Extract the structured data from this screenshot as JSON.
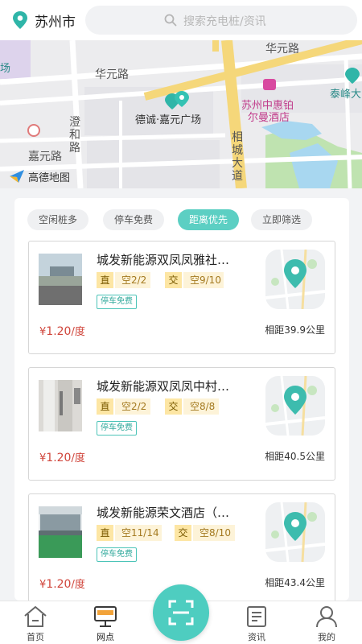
{
  "header": {
    "city": "苏州市",
    "search_placeholder": "搜索充电桩/资讯"
  },
  "map": {
    "labels": {
      "huayuan_road_top": "华元路",
      "huayuan_road_mid": "华元路",
      "huayuan_road_left": "嘉元路",
      "chenghe_road": "澄和路",
      "xiangcheng_ave": "相城大道",
      "poi_center": "德诚·嘉元广场",
      "hotel": "苏州中惠铂尔曼酒店",
      "hotel_line1": "苏州中惠铂",
      "hotel_line2": "尔曼酒店",
      "taifeng": "泰峰大",
      "left_edge": "场"
    },
    "logo_text": "高德地图"
  },
  "filters": [
    {
      "label": "空闲桩多",
      "active": false
    },
    {
      "label": "停车免费",
      "active": false
    },
    {
      "label": "距离优先",
      "active": true
    },
    {
      "label": "立即筛选",
      "active": false
    }
  ],
  "stations": [
    {
      "name": "城发新能源双凤凤雅社…",
      "dc_tag": "直",
      "dc_avail": "空2/2",
      "ac_tag": "交",
      "ac_avail": "空9/10",
      "badge": "停车免费",
      "price_symbol": "¥",
      "price_value": "1.20",
      "price_unit": "/度",
      "distance": "相距39.9公里"
    },
    {
      "name": "城发新能源双凤凤中村…",
      "dc_tag": "直",
      "dc_avail": "空2/2",
      "ac_tag": "交",
      "ac_avail": "空8/8",
      "badge": "停车免费",
      "price_symbol": "¥",
      "price_value": "1.20",
      "price_unit": "/度",
      "distance": "相距40.5公里"
    },
    {
      "name": "城发新能源荣文酒店（…",
      "dc_tag": "直",
      "dc_avail": "空11/14",
      "ac_tag": "交",
      "ac_avail": "空8/10",
      "badge": "停车免费",
      "price_symbol": "¥",
      "price_value": "1.20",
      "price_unit": "/度",
      "distance": "相距43.4公里"
    }
  ],
  "nav": [
    {
      "label": "首页",
      "icon": "home-icon",
      "active": false
    },
    {
      "label": "网点",
      "icon": "station-icon",
      "active": true
    },
    {
      "label": "资讯",
      "icon": "news-icon",
      "active": false
    },
    {
      "label": "我的",
      "icon": "profile-icon",
      "active": false
    }
  ],
  "colors": {
    "accent": "#4ecdc0",
    "price": "#d0453b",
    "dc_tag_bg": "#fde6a4"
  }
}
